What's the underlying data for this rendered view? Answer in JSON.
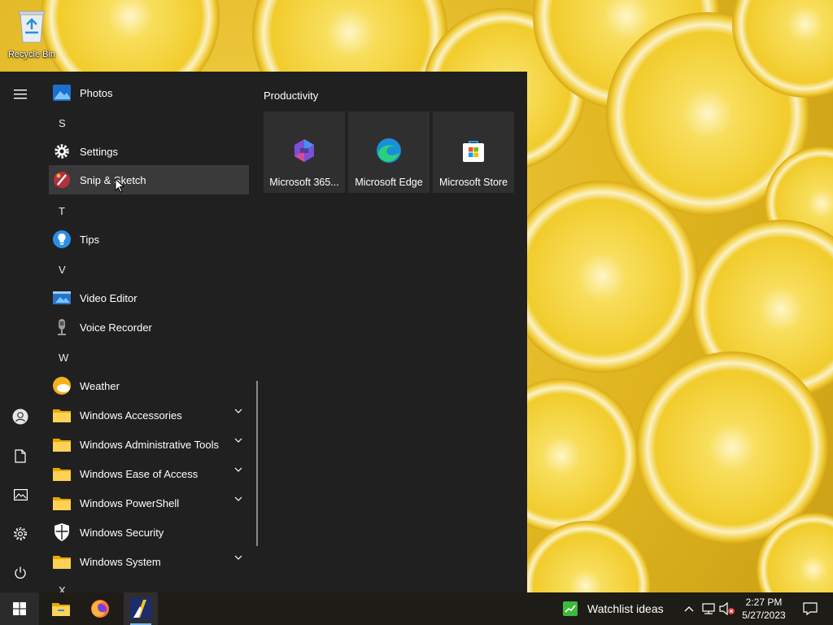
{
  "desktop": {
    "recycle_bin_label": "Recycle Bin"
  },
  "start_menu": {
    "rail": {
      "items": [
        "hamburger-icon",
        "user-icon",
        "documents-icon",
        "pictures-icon",
        "settings-icon",
        "power-icon"
      ]
    },
    "apps": [
      {
        "label": "Photos",
        "icon": "photos-icon"
      },
      {
        "letter": "S"
      },
      {
        "label": "Settings",
        "icon": "settings-gear-icon"
      },
      {
        "label": "Snip & Sketch",
        "icon": "snip-sketch-icon",
        "hovered": true
      },
      {
        "letter": "T"
      },
      {
        "label": "Tips",
        "icon": "tips-icon"
      },
      {
        "letter": "V"
      },
      {
        "label": "Video Editor",
        "icon": "video-editor-icon"
      },
      {
        "label": "Voice Recorder",
        "icon": "voice-recorder-icon"
      },
      {
        "letter": "W"
      },
      {
        "label": "Weather",
        "icon": "weather-icon"
      },
      {
        "label": "Windows Accessories",
        "icon": "folder-icon",
        "expandable": true
      },
      {
        "label": "Windows Administrative Tools",
        "icon": "folder-icon",
        "expandable": true
      },
      {
        "label": "Windows Ease of Access",
        "icon": "folder-icon",
        "expandable": true
      },
      {
        "label": "Windows PowerShell",
        "icon": "folder-icon",
        "expandable": true
      },
      {
        "label": "Windows Security",
        "icon": "shield-icon"
      },
      {
        "label": "Windows System",
        "icon": "folder-icon",
        "expandable": true
      },
      {
        "letter": "X"
      }
    ],
    "group_title": "Productivity",
    "tiles": [
      {
        "label": "Microsoft 365...",
        "icon": "microsoft-365-icon"
      },
      {
        "label": "Microsoft Edge",
        "icon": "edge-icon"
      },
      {
        "label": "Microsoft Store",
        "icon": "store-icon"
      }
    ]
  },
  "taskbar": {
    "apps": [
      "file-explorer-icon",
      "firefox-icon",
      "app-icon"
    ],
    "active_app": "app-icon",
    "news_widget_label": "Watchlist ideas",
    "time": "2:27 PM",
    "date": "5/27/2023"
  },
  "colors": {
    "menu_bg": "#202020",
    "tile_bg": "#2f2f2f",
    "hover_bg": "#3a3a3a",
    "accent": "#79b8f3"
  }
}
